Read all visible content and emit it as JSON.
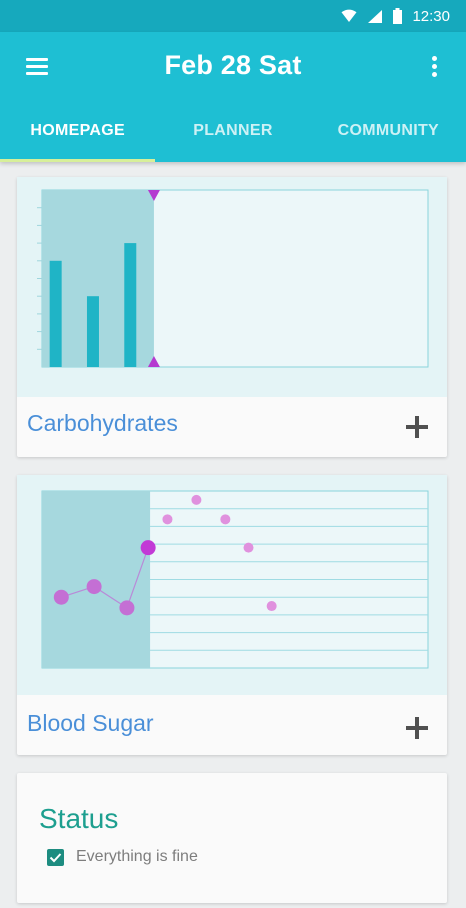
{
  "status_bar": {
    "time": "12:30",
    "icons": [
      "wifi-icon",
      "cell-signal-icon",
      "battery-icon"
    ]
  },
  "app_bar": {
    "title": "Feb 28 Sat",
    "menu_icon": "hamburger-menu-icon",
    "overflow_icon": "more-vert-icon",
    "tabs": [
      {
        "label": "HOMEPAGE",
        "active": true
      },
      {
        "label": "PLANNER",
        "active": false
      },
      {
        "label": "COMMUNITY",
        "active": false
      }
    ]
  },
  "colors": {
    "primary": "#1ebfd3",
    "primary_dark": "#16a9bd",
    "tab_indicator": "#d7ef9a",
    "card_label": "#4a8fd8",
    "bar": "#1fb4c6",
    "marker": "#c23ad6",
    "status_title": "#1d9f8f"
  },
  "carbohydrates": {
    "label": "Carbohydrates",
    "add_icon": "plus-icon",
    "chart_data": {
      "type": "bar",
      "values": [
        0.6,
        0.4,
        0.7
      ],
      "ylim": [
        0,
        1
      ],
      "selected_fraction": 0.29
    }
  },
  "blood_sugar": {
    "label": "Blood Sugar",
    "add_icon": "plus-icon",
    "chart_data": {
      "type": "scatter",
      "xlim": [
        0,
        1
      ],
      "ylim": [
        0,
        1
      ],
      "selected_fraction": 0.28,
      "highlighted_points": [
        {
          "x": 0.05,
          "y": 0.4
        },
        {
          "x": 0.135,
          "y": 0.46
        },
        {
          "x": 0.22,
          "y": 0.34
        },
        {
          "x": 0.275,
          "y": 0.68
        }
      ],
      "other_points": [
        {
          "x": 0.325,
          "y": 0.84
        },
        {
          "x": 0.4,
          "y": 0.95
        },
        {
          "x": 0.475,
          "y": 0.84
        },
        {
          "x": 0.535,
          "y": 0.68
        },
        {
          "x": 0.595,
          "y": 0.35
        }
      ]
    }
  },
  "status": {
    "title": "Status",
    "item_text": "Everything is fine",
    "checked": true
  }
}
